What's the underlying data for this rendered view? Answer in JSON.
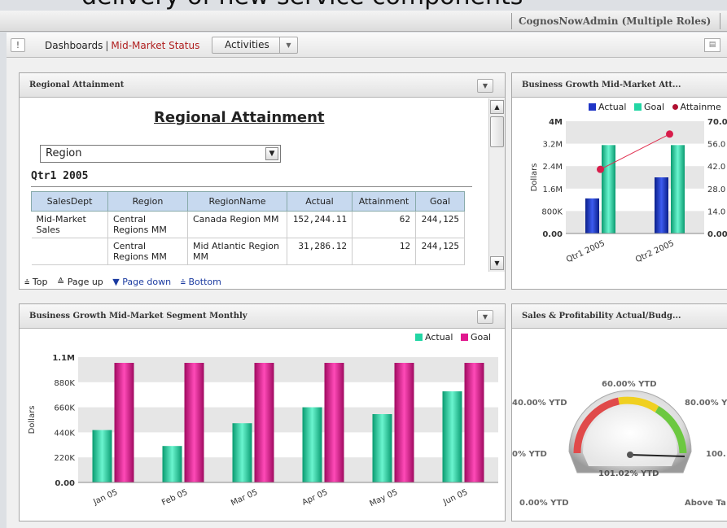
{
  "header": {
    "headline": "delivery of new service components",
    "user": "CognosNowAdmin (Multiple Roles)"
  },
  "toolbar": {
    "info_label": "!",
    "breadcrumb_root": "Dashboards",
    "breadcrumb_sep": "|",
    "breadcrumb_current": "Mid-Market Status",
    "activities_label": "Activities"
  },
  "regional": {
    "widget_title": "Regional Attainment",
    "title": "Regional Attainment",
    "region_select": "Region",
    "period": "Qtr1 2005",
    "columns": [
      "SalesDept",
      "Region",
      "RegionName",
      "Actual",
      "Attainment",
      "Goal"
    ],
    "rows": [
      [
        "Mid-Market Sales",
        "Central Regions MM",
        "Canada Region MM",
        "152,244.11",
        "62",
        "244,125"
      ],
      [
        "",
        "Central Regions MM",
        "Mid Atlantic Region MM",
        "31,286.12",
        "12",
        "244,125"
      ]
    ],
    "pager": {
      "top": "Top",
      "page_up": "Page up",
      "page_down": "Page down",
      "bottom": "Bottom"
    }
  },
  "growth": {
    "widget_title": "Business Growth Mid-Market Att...",
    "legend": [
      "Actual",
      "Goal",
      "Attainme"
    ]
  },
  "monthly": {
    "widget_title": "Business Growth Mid-Market Segment Monthly",
    "legend": [
      "Actual",
      "Goal"
    ]
  },
  "sales": {
    "widget_title": "Sales & Profitability Actual/Budg...",
    "labels": {
      "top": "60.00% YTD",
      "upper_left": "40.00% YTD",
      "upper_right": "80.00% Y",
      "left": "0% YTD",
      "right": "100.",
      "center": "101.02% YTD",
      "bottom_left": "0.00% YTD",
      "bottom_right": "Above Ta"
    },
    "gauge_value": 101.02
  },
  "colors": {
    "actual_blue": "#1f35c6",
    "goal_teal": "#22d6a4",
    "attainment_red": "#d81d4b",
    "goal_magenta": "#e0188e"
  },
  "chart_data": [
    {
      "type": "bar",
      "title": "Business Growth Mid-Market Att...",
      "ylabel": "Dollars",
      "categories": [
        "Qtr1 2005",
        "Qtr2 2005"
      ],
      "ylim": [
        0,
        4000000
      ],
      "yticks": [
        "0.00",
        "800K",
        "1.6M",
        "2.4M",
        "3.2M",
        "4M"
      ],
      "y2ticks": [
        "0.00",
        "14.0",
        "28.0",
        "42.0",
        "56.0",
        "70.0"
      ],
      "series": [
        {
          "name": "Actual",
          "values": [
            1250000,
            2000000
          ]
        },
        {
          "name": "Goal",
          "values": [
            3150000,
            3150000
          ]
        },
        {
          "name": "Attainme",
          "type": "line",
          "axis": "secondary",
          "values": [
            40,
            62
          ]
        }
      ]
    },
    {
      "type": "bar",
      "title": "Business Growth Mid-Market Segment Monthly",
      "ylabel": "Dollars",
      "categories": [
        "Jan 05",
        "Feb 05",
        "Mar 05",
        "Apr 05",
        "May 05",
        "Jun 05"
      ],
      "ylim": [
        0,
        1100000
      ],
      "yticks": [
        "0.00",
        "220K",
        "440K",
        "660K",
        "880K",
        "1.1M"
      ],
      "series": [
        {
          "name": "Actual",
          "values": [
            460000,
            320000,
            520000,
            660000,
            600000,
            800000
          ]
        },
        {
          "name": "Goal",
          "values": [
            1050000,
            1050000,
            1050000,
            1050000,
            1050000,
            1050000
          ]
        }
      ]
    }
  ]
}
